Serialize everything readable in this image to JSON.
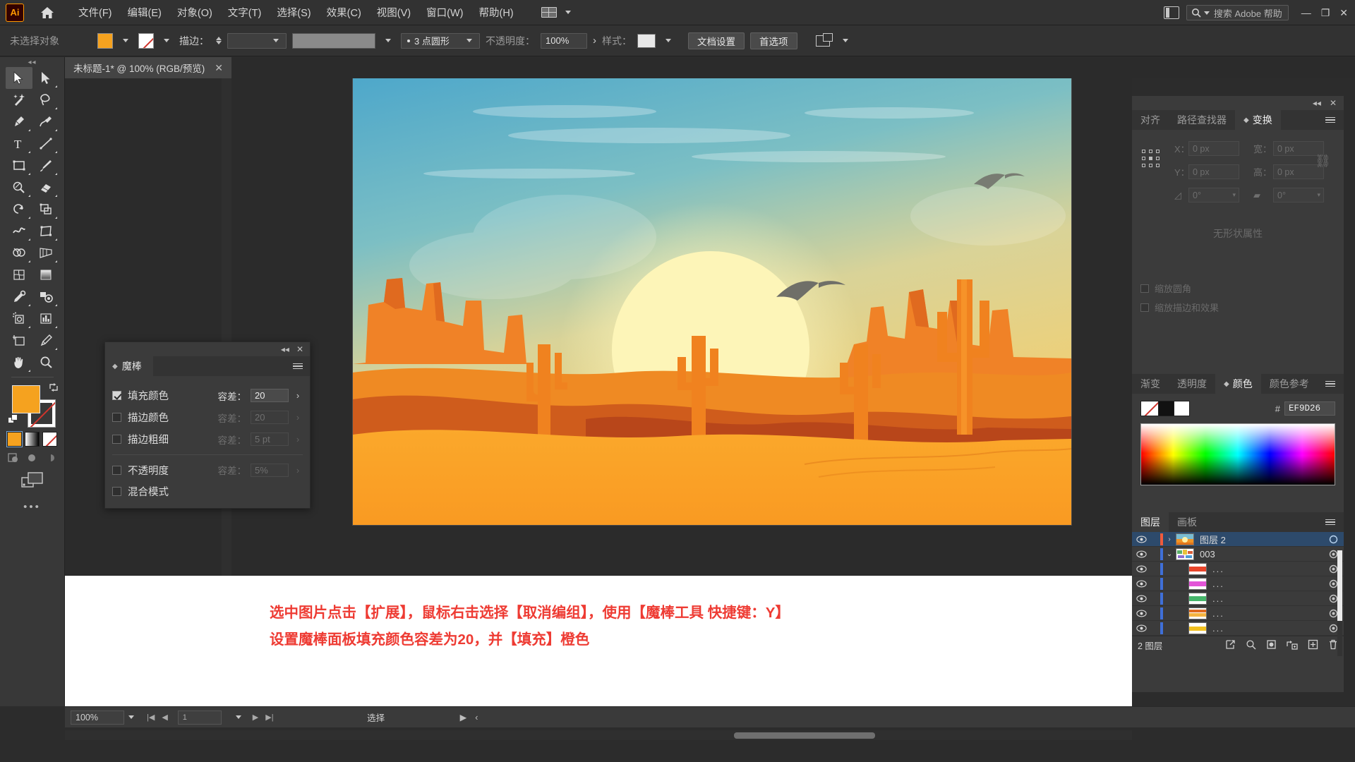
{
  "app": {
    "logo_text": "Ai",
    "menus": [
      {
        "label": "文件(F)"
      },
      {
        "label": "编辑(E)"
      },
      {
        "label": "对象(O)"
      },
      {
        "label": "文字(T)"
      },
      {
        "label": "选择(S)"
      },
      {
        "label": "效果(C)"
      },
      {
        "label": "视图(V)"
      },
      {
        "label": "窗口(W)"
      },
      {
        "label": "帮助(H)"
      }
    ],
    "search_placeholder": "搜索 Adobe 帮助",
    "window_buttons": {
      "minimize": "—",
      "restore": "❐",
      "close": "✕"
    }
  },
  "control_bar": {
    "selection_status": "未选择对象",
    "stroke_label": "描边：",
    "stroke_weight": "",
    "stroke_profile": "",
    "brush_definition": "3 点圆形",
    "opacity_label": "不透明度：",
    "opacity_value": "100%",
    "style_label": "样式：",
    "doc_setup_button": "文档设置",
    "preferences_button": "首选项"
  },
  "document_tab": {
    "title": "未标题-1* @ 100% (RGB/预览)",
    "close": "✕"
  },
  "toolbar": {
    "tools": [
      {
        "name": "selection-tool",
        "active": true
      },
      {
        "name": "direct-selection-tool",
        "active": false
      },
      {
        "name": "magic-wand-tool",
        "active": false
      },
      {
        "name": "lasso-tool",
        "active": false
      },
      {
        "name": "pen-tool",
        "active": false
      },
      {
        "name": "curvature-tool",
        "active": false
      },
      {
        "name": "type-tool",
        "active": false
      },
      {
        "name": "line-segment-tool",
        "active": false
      },
      {
        "name": "rectangle-tool",
        "active": false
      },
      {
        "name": "paintbrush-tool",
        "active": false
      },
      {
        "name": "shaper-tool",
        "active": false
      },
      {
        "name": "eraser-tool",
        "active": false
      },
      {
        "name": "rotate-tool",
        "active": false
      },
      {
        "name": "scale-tool",
        "active": false
      },
      {
        "name": "width-tool",
        "active": false
      },
      {
        "name": "free-transform-tool",
        "active": false
      },
      {
        "name": "shape-builder-tool",
        "active": false
      },
      {
        "name": "perspective-grid-tool",
        "active": false
      },
      {
        "name": "mesh-tool",
        "active": false
      },
      {
        "name": "gradient-tool",
        "active": false
      },
      {
        "name": "eyedropper-tool",
        "active": false
      },
      {
        "name": "blend-tool",
        "active": false
      },
      {
        "name": "symbol-sprayer-tool",
        "active": false
      },
      {
        "name": "column-graph-tool",
        "active": false
      },
      {
        "name": "artboard-tool",
        "active": false
      },
      {
        "name": "slice-tool",
        "active": false
      },
      {
        "name": "hand-tool",
        "active": false
      },
      {
        "name": "zoom-tool",
        "active": false
      }
    ],
    "fill_color": "#F5A21F",
    "stroke_color": "none",
    "more_tools": "•••"
  },
  "magic_wand_panel": {
    "tab_title": "魔棒",
    "rows": [
      {
        "label": "填充颜色",
        "checked": true,
        "tolerance_label": "容差：",
        "tolerance": "20",
        "enabled": true
      },
      {
        "label": "描边颜色",
        "checked": false,
        "tolerance_label": "容差：",
        "tolerance": "20",
        "enabled": false
      },
      {
        "label": "描边粗细",
        "checked": false,
        "tolerance_label": "容差：",
        "tolerance": "5 pt",
        "enabled": false
      },
      {
        "label": "不透明度",
        "checked": false,
        "tolerance_label": "容差：",
        "tolerance": "5%",
        "enabled": false
      },
      {
        "label": "混合模式",
        "checked": false,
        "tolerance_label": "",
        "tolerance": "",
        "enabled": false
      }
    ],
    "close": "✕",
    "collapse": "◂◂"
  },
  "transform_panel": {
    "tabs": [
      {
        "label": "对齐",
        "active": false
      },
      {
        "label": "路径查找器",
        "active": false
      },
      {
        "label": "变换",
        "active": true
      }
    ],
    "fields": {
      "x_label": "X：",
      "x_value": "0 px",
      "y_label": "Y：",
      "y_value": "0 px",
      "w_label": "宽：",
      "w_value": "0 px",
      "h_label": "高：",
      "h_value": "0 px",
      "angle_value": "0°",
      "shear_value": "0°"
    },
    "empty_text": "无形状属性",
    "options": [
      {
        "label": "缩放圆角"
      },
      {
        "label": "缩放描边和效果"
      }
    ],
    "close": "✕",
    "collapse": "◂◂"
  },
  "color_panel": {
    "tabs": [
      {
        "label": "渐变",
        "active": false
      },
      {
        "label": "透明度",
        "active": false
      },
      {
        "label": "颜色",
        "active": true
      },
      {
        "label": "颜色参考",
        "active": false
      }
    ],
    "hash": "#",
    "hex_value": "EF9D26"
  },
  "layers_panel": {
    "tabs": [
      {
        "label": "图层",
        "active": true
      },
      {
        "label": "画板",
        "active": false
      }
    ],
    "rows": [
      {
        "name": "图层 2",
        "selected": true,
        "indent": 0,
        "twirl": "›",
        "thumb": "sunset",
        "color": "#ef5a3c"
      },
      {
        "name": "003",
        "selected": false,
        "indent": 0,
        "twirl": "⌄",
        "thumb": "stripes",
        "color": "#3f6fd8"
      },
      {
        "name": "...",
        "selected": false,
        "indent": 1,
        "twirl": "",
        "thumb": "red",
        "color": "#3f6fd8"
      },
      {
        "name": "...",
        "selected": false,
        "indent": 1,
        "twirl": "",
        "thumb": "magenta",
        "color": "#3f6fd8"
      },
      {
        "name": "...",
        "selected": false,
        "indent": 1,
        "twirl": "",
        "thumb": "green",
        "color": "#3f6fd8"
      },
      {
        "name": "...",
        "selected": false,
        "indent": 1,
        "twirl": "",
        "thumb": "orange",
        "color": "#3f6fd8"
      },
      {
        "name": "...",
        "selected": false,
        "indent": 1,
        "twirl": "",
        "thumb": "yellow",
        "color": "#3f6fd8"
      }
    ],
    "footer_count": "2 图层"
  },
  "annotation": {
    "line1": "选中图片点击【扩展】，鼠标右击选择【取消编组】，使用【魔棒工具 快捷键：Y】",
    "line2": "设置魔棒面板填充颜色容差为20，并【填充】橙色",
    "color": "#EE3B33"
  },
  "status_bar": {
    "zoom": "100%",
    "page": "1",
    "status_text": "选择"
  },
  "artwork": {
    "description": "desert-sunset-illustration",
    "sky_top": "#4aa3c7",
    "sky_mid": "#f0dc8a",
    "sun": "#fdf4b4",
    "dune_front": "#f9a227",
    "dune_back": "#d95f1e",
    "cactus": "#f07b1f"
  }
}
